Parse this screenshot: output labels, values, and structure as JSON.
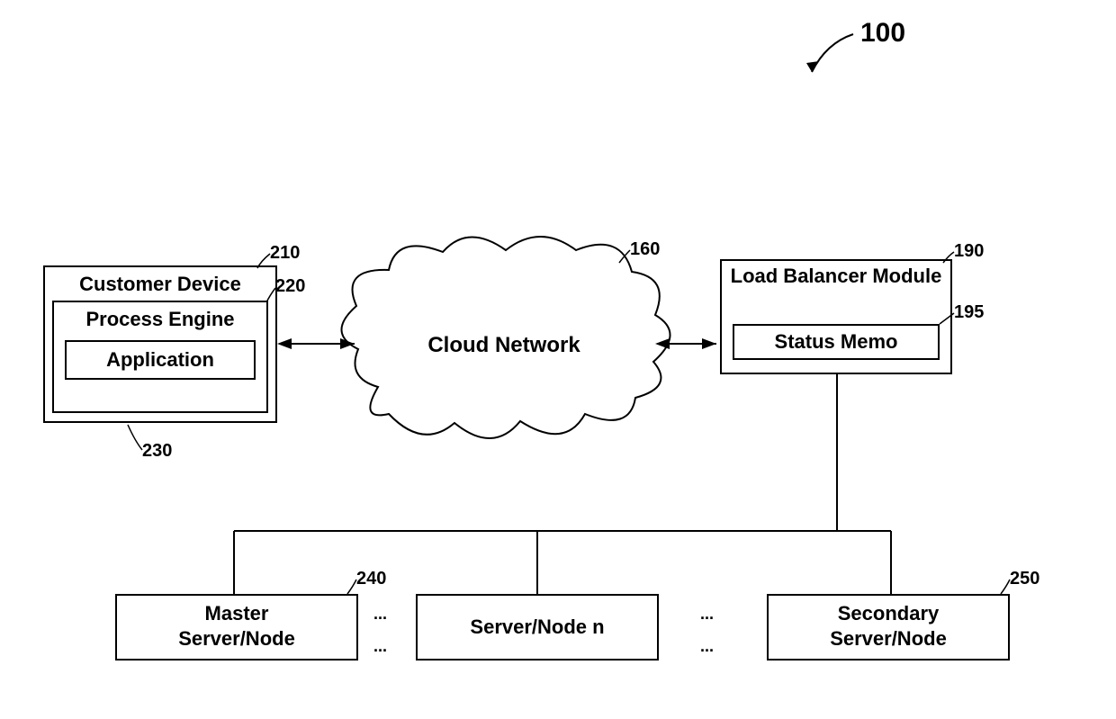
{
  "figure_ref": "100",
  "customer_device": {
    "title": "Customer Device",
    "ref": "210",
    "process_engine": {
      "title": "Process Engine",
      "ref": "220"
    },
    "application": {
      "title": "Application",
      "ref": "230"
    }
  },
  "cloud": {
    "title": "Cloud Network",
    "ref": "160"
  },
  "load_balancer": {
    "title": "Load Balancer Module",
    "ref": "190",
    "status_memo": {
      "title": "Status Memo",
      "ref": "195"
    }
  },
  "servers": {
    "master": {
      "title_l1": "Master",
      "title_l2": "Server/Node",
      "ref": "240"
    },
    "n": {
      "title": "Server/Node n"
    },
    "secondary": {
      "title_l1": "Secondary",
      "title_l2": "Server/Node",
      "ref": "250"
    },
    "ellipsis": "..."
  }
}
